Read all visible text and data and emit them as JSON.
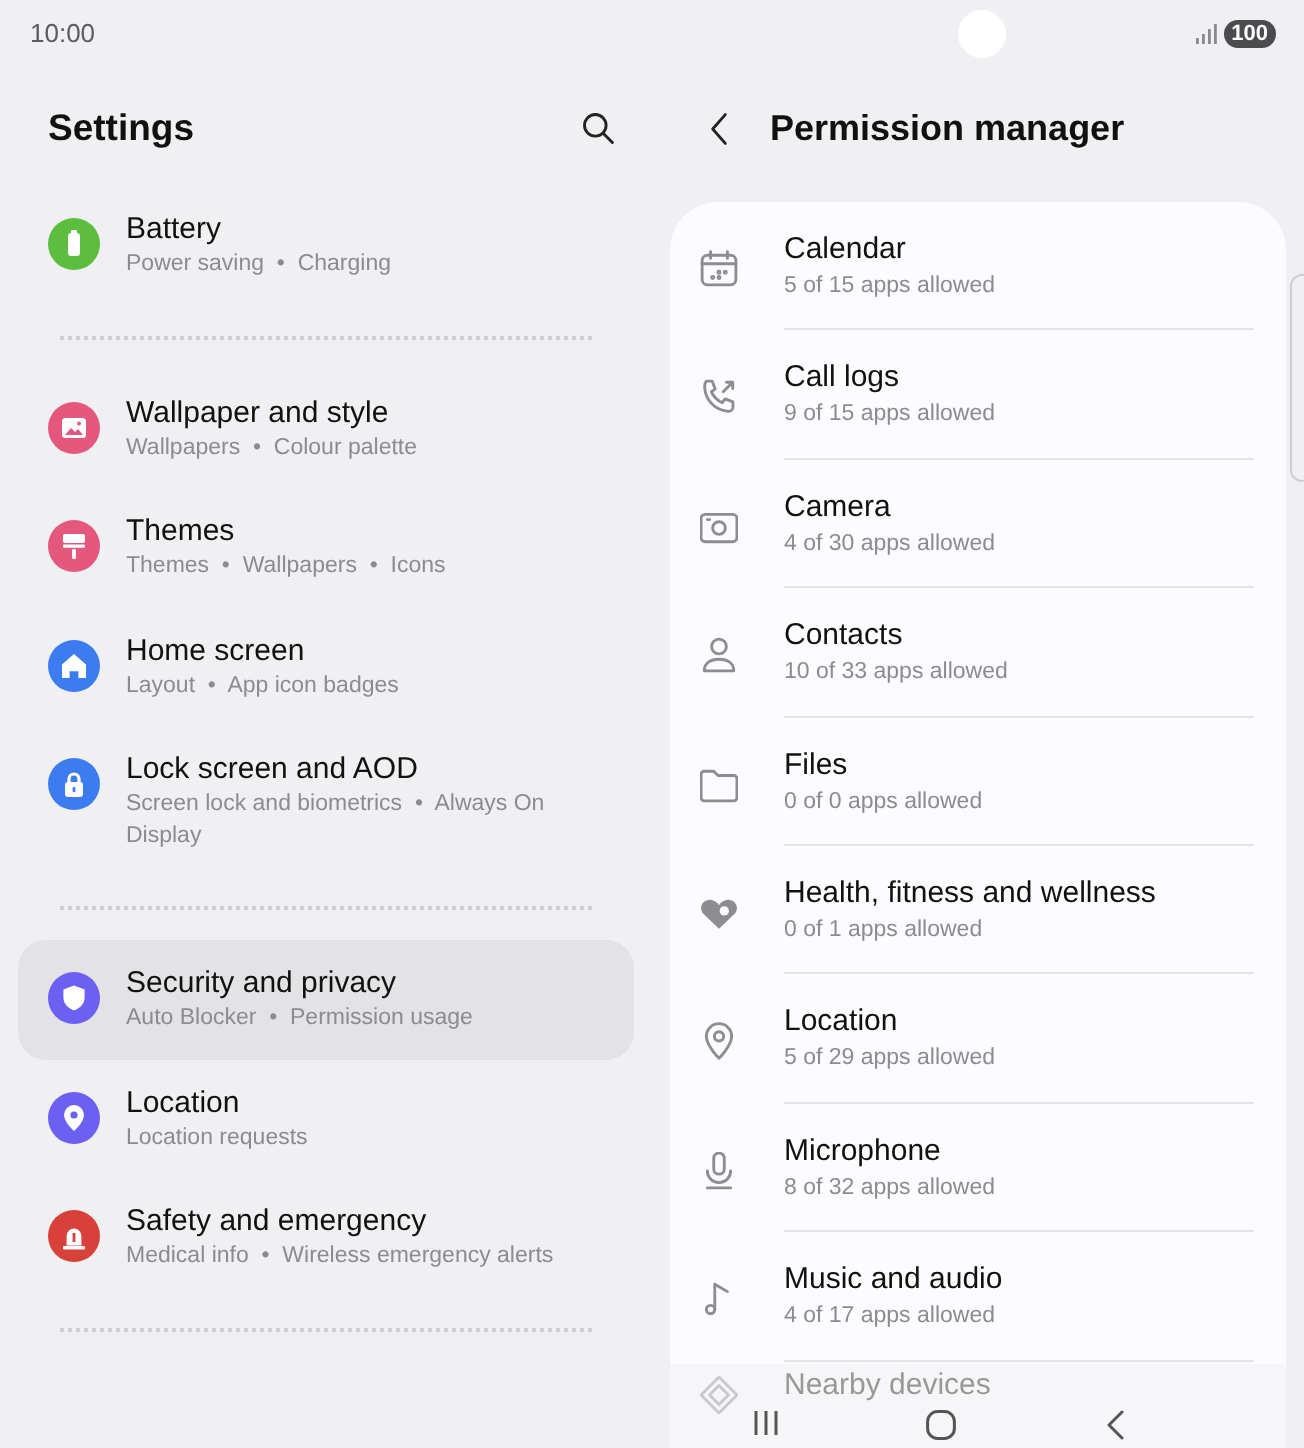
{
  "status_bar": {
    "time": "10:00",
    "battery": "100"
  },
  "settings": {
    "title": "Settings",
    "groups": [
      {
        "items": [
          {
            "title": "Battery",
            "subtitle": "Power saving  •  Charging",
            "color": "#5cbd3f",
            "selected": false
          }
        ]
      },
      {
        "items": [
          {
            "title": "Wallpaper and style",
            "subtitle": "Wallpapers  •  Colour palette",
            "color": "#e5587d",
            "selected": false
          },
          {
            "title": "Themes",
            "subtitle": "Themes  •  Wallpapers  •  Icons",
            "color": "#e5587d",
            "selected": false
          },
          {
            "title": "Home screen",
            "subtitle": "Layout  •  App icon badges",
            "color": "#3c7cf0",
            "selected": false
          },
          {
            "title": "Lock screen and AOD",
            "subtitle": "Screen lock and biometrics  •  Always On Display",
            "color": "#3c7cf0",
            "selected": false
          }
        ]
      },
      {
        "items": [
          {
            "title": "Security and privacy",
            "subtitle": "Auto Blocker  •  Permission usage",
            "color": "#6c60f2",
            "selected": true
          },
          {
            "title": "Location",
            "subtitle": "Location requests",
            "color": "#6c60f2",
            "selected": false
          },
          {
            "title": "Safety and emergency",
            "subtitle": "Medical info  •  Wireless emergency alerts",
            "color": "#d8403a",
            "selected": false
          }
        ]
      }
    ]
  },
  "permission_manager": {
    "title": "Permission manager",
    "permissions": [
      {
        "name": "Calendar",
        "summary": "5 of 15 apps allowed"
      },
      {
        "name": "Call logs",
        "summary": "9 of 15 apps allowed"
      },
      {
        "name": "Camera",
        "summary": "4 of 30 apps allowed"
      },
      {
        "name": "Contacts",
        "summary": "10 of 33 apps allowed"
      },
      {
        "name": "Files",
        "summary": "0 of 0 apps allowed"
      },
      {
        "name": "Health, fitness and wellness",
        "summary": "0 of 1 apps allowed"
      },
      {
        "name": "Location",
        "summary": "5 of 29 apps allowed"
      },
      {
        "name": "Microphone",
        "summary": "8 of 32 apps allowed"
      },
      {
        "name": "Music and audio",
        "summary": "4 of 17 apps allowed"
      },
      {
        "name": "Nearby devices"
      }
    ]
  }
}
